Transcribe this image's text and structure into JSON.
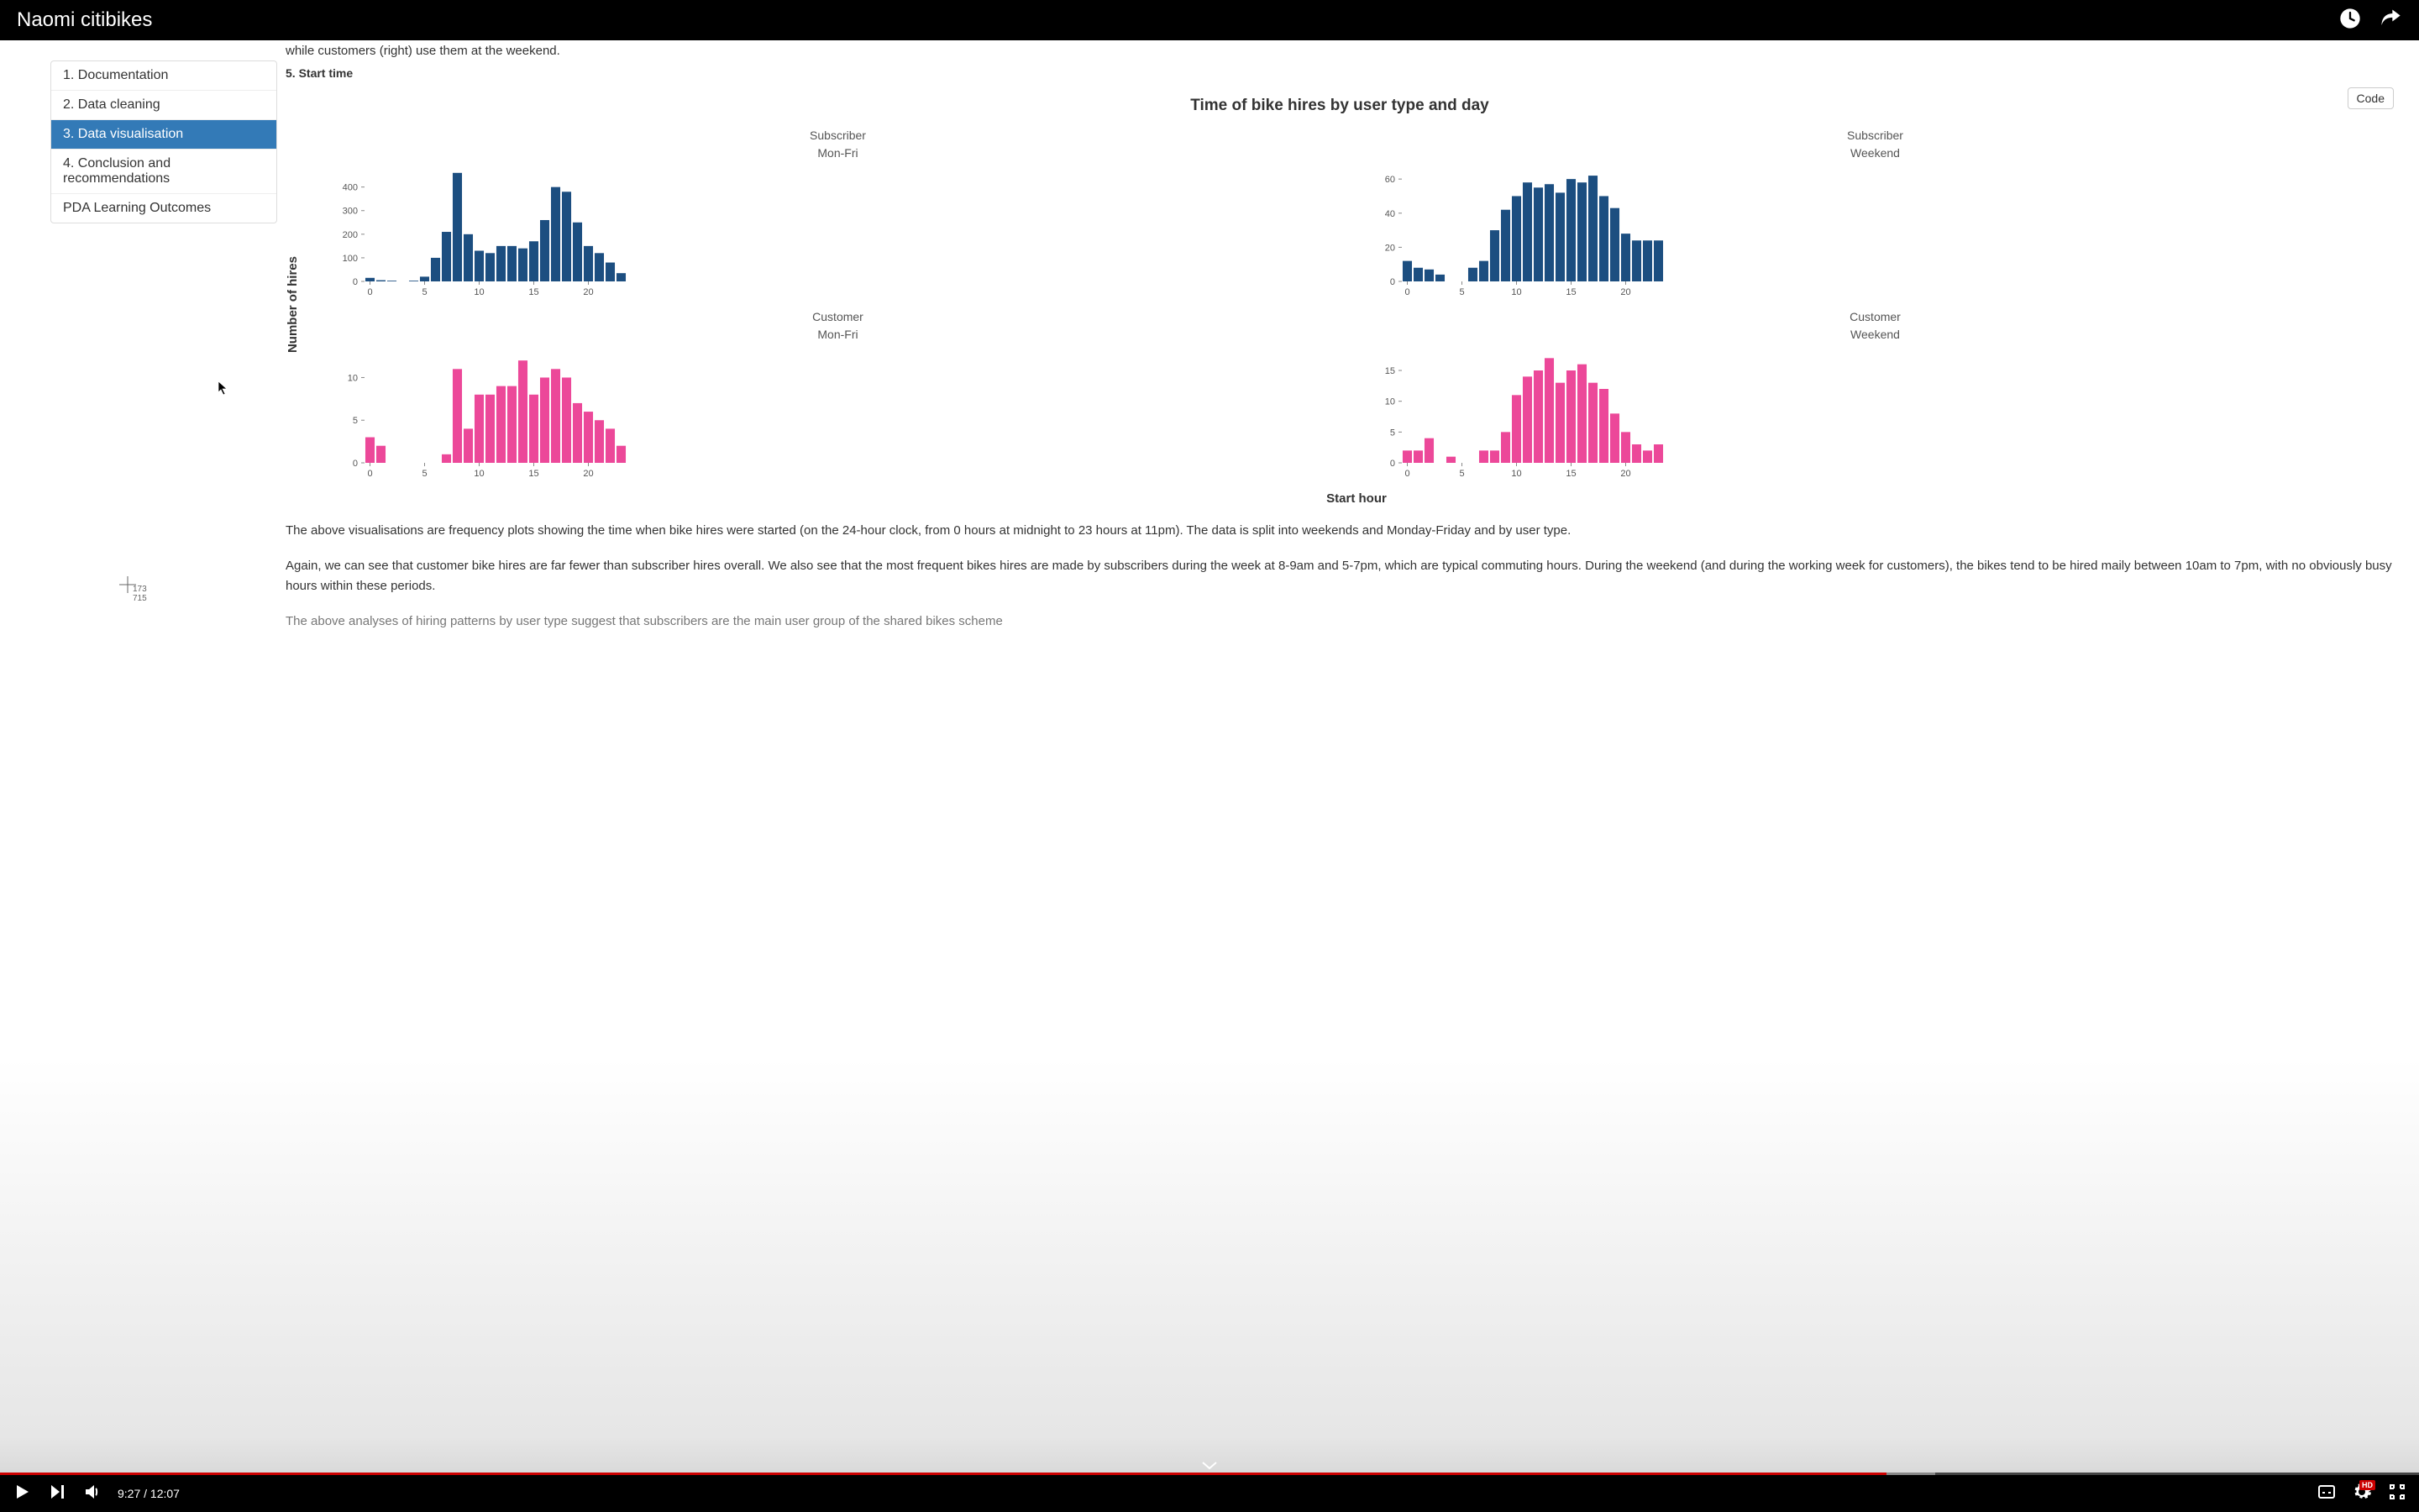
{
  "video": {
    "title": "Naomi citibikes",
    "current_time": "9:27",
    "duration": "12:07",
    "progress_pct": 78,
    "buffered_pct": 80
  },
  "toc": {
    "items": [
      {
        "label": "1. Documentation",
        "active": false
      },
      {
        "label": "2. Data cleaning",
        "active": false
      },
      {
        "label": "3. Data visualisation",
        "active": true
      },
      {
        "label": "4. Conclusion and recommendations",
        "active": false
      },
      {
        "label": "PDA Learning Outcomes",
        "active": false
      }
    ]
  },
  "document": {
    "lead_in": "while customers (right) use them at the weekend.",
    "section_heading": "5. Start time",
    "code_button": "Code",
    "paragraph1": "The above visualisations are frequency plots showing the time when bike hires were started (on the 24-hour clock, from 0 hours at midnight to 23 hours at 11pm). The data is split into weekends and Monday-Friday and by user type.",
    "paragraph2": "Again, we can see that customer bike hires are far fewer than subscriber hires overall. We also see that the most frequent bikes hires are made by subscribers during the week at 8-9am and 5-7pm, which are typical commuting hours. During the weekend (and during the working week for customers), the bikes tend to be hired maily between 10am to 7pm, with no obviously busy hours within these periods.",
    "paragraph3_cut": "The above analyses of hiring patterns by user type suggest that subscribers are the main user group of the shared bikes scheme"
  },
  "crosshair": {
    "x": "173",
    "y": "715"
  },
  "chart_data": {
    "type": "bar",
    "title": "Time of bike hires by user type and day",
    "xlabel": "Start hour",
    "ylabel": "Number of hires",
    "x_ticks": [
      0,
      5,
      10,
      15,
      20
    ],
    "panels": [
      {
        "id": "sub_monfri",
        "user": "Subscriber",
        "day": "Mon-Fri",
        "color": "sub",
        "ylim": [
          0,
          470
        ],
        "y_ticks": [
          0,
          100,
          200,
          300,
          400
        ],
        "x": [
          0,
          1,
          2,
          3,
          4,
          5,
          6,
          7,
          8,
          9,
          10,
          11,
          12,
          13,
          14,
          15,
          16,
          17,
          18,
          19,
          20,
          21,
          22,
          23
        ],
        "values": [
          15,
          5,
          3,
          0,
          3,
          20,
          100,
          210,
          460,
          200,
          130,
          120,
          150,
          150,
          140,
          170,
          260,
          400,
          380,
          250,
          150,
          120,
          80,
          35
        ]
      },
      {
        "id": "sub_weekend",
        "user": "Subscriber",
        "day": "Weekend",
        "color": "sub",
        "ylim": [
          0,
          65
        ],
        "y_ticks": [
          0,
          20,
          40,
          60
        ],
        "x": [
          0,
          1,
          2,
          3,
          4,
          5,
          6,
          7,
          8,
          9,
          10,
          11,
          12,
          13,
          14,
          15,
          16,
          17,
          18,
          19,
          20,
          21,
          22,
          23
        ],
        "values": [
          12,
          8,
          7,
          4,
          0,
          0,
          8,
          12,
          30,
          42,
          50,
          58,
          55,
          57,
          52,
          60,
          58,
          62,
          50,
          43,
          28,
          24,
          24,
          24
        ]
      },
      {
        "id": "cust_monfri",
        "user": "Customer",
        "day": "Mon-Fri",
        "color": "cust",
        "ylim": [
          0,
          13
        ],
        "y_ticks": [
          0,
          5,
          10
        ],
        "x": [
          0,
          1,
          2,
          3,
          4,
          5,
          6,
          7,
          8,
          9,
          10,
          11,
          12,
          13,
          14,
          15,
          16,
          17,
          18,
          19,
          20,
          21,
          22,
          23
        ],
        "values": [
          3,
          2,
          0,
          0,
          0,
          0,
          0,
          1,
          11,
          4,
          8,
          8,
          9,
          9,
          12,
          8,
          10,
          11,
          10,
          7,
          6,
          5,
          4,
          2
        ]
      },
      {
        "id": "cust_weekend",
        "user": "Customer",
        "day": "Weekend",
        "color": "cust",
        "ylim": [
          0,
          18
        ],
        "y_ticks": [
          0,
          5,
          10,
          15
        ],
        "x": [
          0,
          1,
          2,
          3,
          4,
          5,
          6,
          7,
          8,
          9,
          10,
          11,
          12,
          13,
          14,
          15,
          16,
          17,
          18,
          19,
          20,
          21,
          22,
          23
        ],
        "values": [
          2,
          2,
          4,
          0,
          1,
          0,
          0,
          2,
          2,
          5,
          11,
          14,
          15,
          17,
          13,
          15,
          16,
          13,
          12,
          8,
          5,
          3,
          2,
          3
        ]
      }
    ]
  }
}
